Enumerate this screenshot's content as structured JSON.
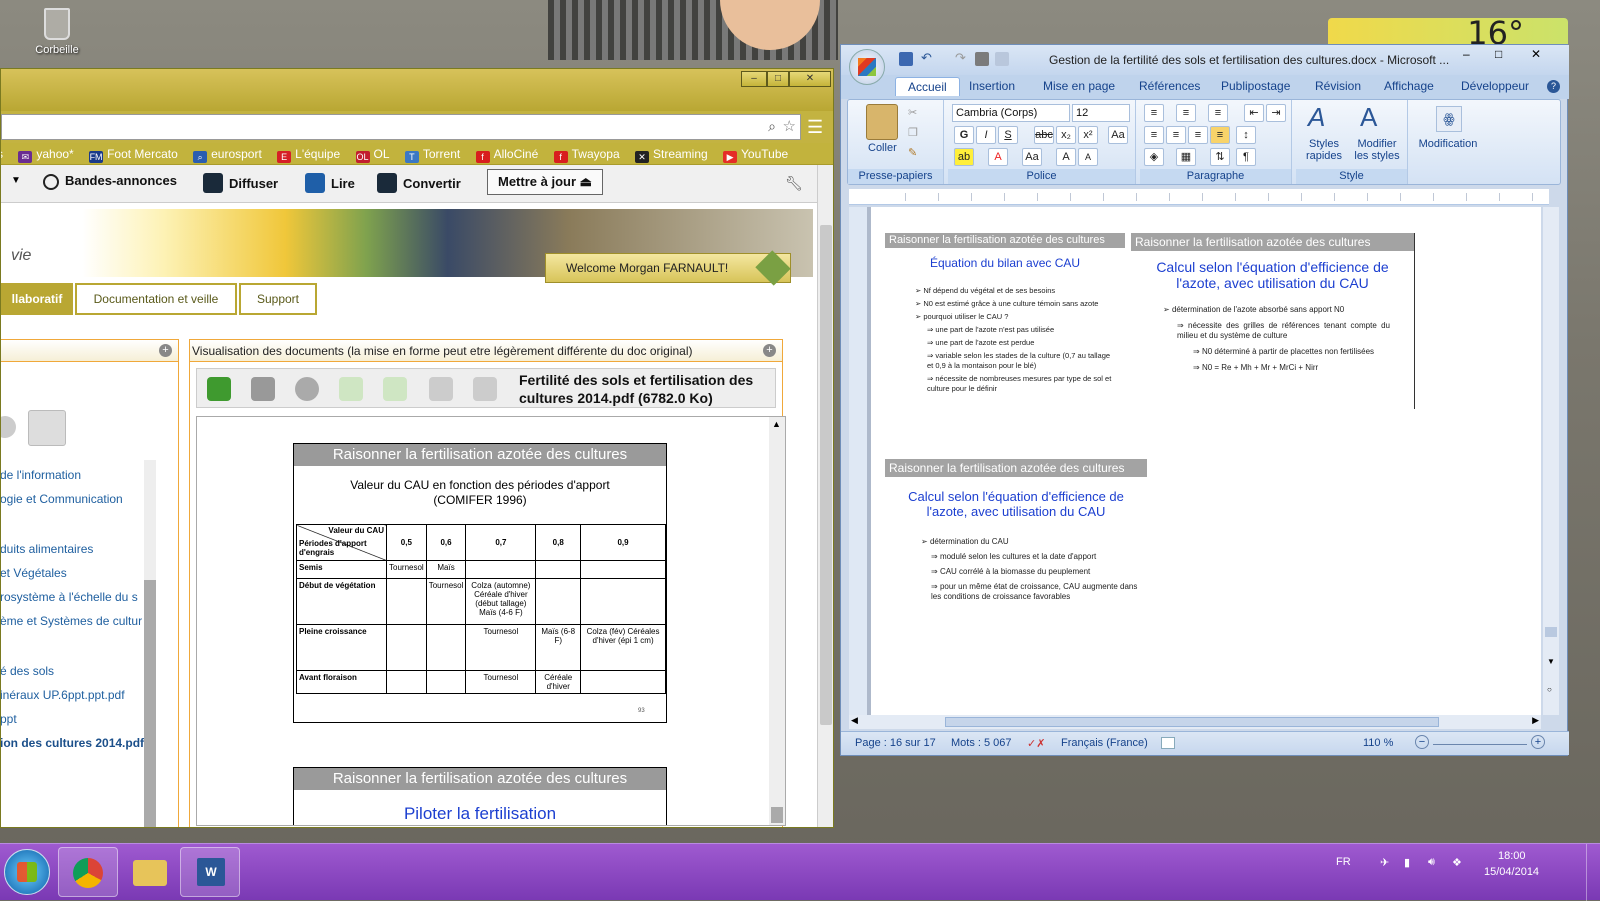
{
  "desktop": {
    "recycle_bin": "Corbeille",
    "weather_temp": "16°"
  },
  "browser": {
    "bookmarks": [
      {
        "label": "yahoo*",
        "icon": "yahoo-icon",
        "color": "#6a2c91"
      },
      {
        "label": "Foot Mercato",
        "icon": "fm-icon",
        "color": "#1a3a8a"
      },
      {
        "label": "eurosport",
        "icon": "search-icon",
        "color": "#2a5db0"
      },
      {
        "label": "L'équipe",
        "icon": "lequipe-icon",
        "color": "#d61f26"
      },
      {
        "label": "OL",
        "icon": "ol-icon",
        "color": "#c21e2e"
      },
      {
        "label": "Torrent",
        "icon": "torrent-icon",
        "color": "#3b78c4"
      },
      {
        "label": "AlloCiné",
        "icon": "free-icon",
        "color": "#d81e1e"
      },
      {
        "label": "Twayopa",
        "icon": "free-icon",
        "color": "#d81e1e"
      },
      {
        "label": "Streaming",
        "icon": "streaming-icon",
        "color": "#222222"
      },
      {
        "label": "YouTube",
        "icon": "youtube-icon",
        "color": "#e52d27"
      }
    ],
    "toolbar": {
      "trailers": "Bandes-annonces",
      "broadcast": "Diffuser",
      "read": "Lire",
      "convert": "Convertir",
      "update": "Mettre à jour"
    },
    "site": {
      "logo_text": "vie",
      "welcome": "Welcome Morgan FARNAULT!",
      "tabs": [
        "llaboratif",
        "Documentation et veille",
        "Support"
      ],
      "left_links": [
        "de l'information",
        "ogie et Communication",
        "duits alimentaires",
        "et Végétales",
        "rosystème à l'échelle du s",
        "ème et Systèmes de culture",
        "é des sols",
        "inéraux UP.6ppt.ppt.pdf",
        "ppt",
        "ion des cultures 2014.pdf"
      ],
      "viewer_header": "Visualisation des documents (la mise en forme peut etre légèrement différente du doc original)",
      "doc_title": "Fertilité des sols et fertilisation des cultures 2014.pdf (6782.0 Ko)"
    },
    "pdf": {
      "slide1_header": "Raisonner la fertilisation azotée des cultures",
      "slide1_title": "Valeur du CAU en fonction des périodes d'apport (COMIFER 1996)",
      "table_header_top": "Valeur du CAU",
      "table_header_left": "Périodes d'apport d'engrais",
      "table_cols": [
        "0,5",
        "0,6",
        "0,7",
        "0,8",
        "0,9"
      ],
      "table_rows": [
        {
          "period": "Semis",
          "cells": [
            "Tournesol",
            "Maïs",
            "",
            "",
            ""
          ]
        },
        {
          "period": "Début de végétation",
          "cells": [
            "",
            "Tournesol",
            "Colza (automne) Céréale d'hiver (début tallage) Maïs (4-6 F)",
            "",
            ""
          ]
        },
        {
          "period": "Pleine croissance",
          "cells": [
            "",
            "",
            "Tournesol",
            "Maïs (6-8 F)",
            "Colza (fév) Céréales d'hiver (épi 1 cm)"
          ]
        },
        {
          "period": "Avant floraison",
          "cells": [
            "",
            "",
            "Tournesol",
            "Céréale d'hiver",
            ""
          ]
        }
      ],
      "page_num": "93",
      "slide2_header": "Raisonner la fertilisation azotée des cultures",
      "slide2_title": "Piloter la fertilisation"
    }
  },
  "word": {
    "title": "Gestion de la fertilité des sols et fertilisation des cultures.docx - Microsoft ...",
    "tabs": [
      "Accueil",
      "Insertion",
      "Mise en page",
      "Références",
      "Publipostage",
      "Révision",
      "Affichage",
      "Développeur"
    ],
    "font_name": "Cambria (Corps)",
    "font_size": "12",
    "groups": [
      "Presse-papiers",
      "Police",
      "Paragraphe",
      "Style"
    ],
    "paste": "Coller",
    "styles_quick": "Styles rapides",
    "styles_modify": "Modifier les styles",
    "editing": "Modification",
    "doc": {
      "s1_header": "Raisonner la fertilisation azotée des cultures",
      "s1_title": "Équation du bilan avec CAU",
      "s1_bullets": [
        "Nf dépend du végétal et de ses besoins",
        "N0 est estimé grâce à une culture témoin sans azote",
        "pourquoi utiliser le CAU ?",
        "une part de l'azote n'est pas utilisée",
        "une part de l'azote est perdue",
        "variable selon les stades de la culture (0,7 au tallage et 0,9 à la montaison pour le blé)",
        "nécessite de nombreuses mesures par type de sol et culture pour le définir"
      ],
      "s2_header": "Raisonner la fertilisation azotée des cultures",
      "s2_title": "Calcul selon l'équation d'efficience de l'azote, avec utilisation du CAU",
      "s2_bullets": [
        "détermination de l'azote absorbé sans apport N0",
        "nécessite des grilles de références tenant compte du milieu et du système de culture",
        "N0 déterminé à partir de placettes non fertilisées",
        "N0 = Re + Mh + Mr + MrCi + Nirr"
      ],
      "s3_header": "Raisonner la fertilisation azotée des cultures",
      "s3_title": "Calcul selon l'équation d'efficience de l'azote, avec utilisation du CAU",
      "s3_bullets": [
        "détermination du CAU",
        "modulé selon les cultures et la date d'apport",
        "CAU corrélé à la biomasse du peuplement",
        "pour un même état de croissance, CAU augmente dans les conditions de croissance favorables"
      ]
    },
    "status": {
      "page": "Page : 16 sur 17",
      "words": "Mots : 5 067",
      "language": "Français (France)",
      "zoom": "110 %"
    }
  },
  "taskbar": {
    "lang": "FR",
    "time": "18:00",
    "date": "15/04/2014"
  }
}
